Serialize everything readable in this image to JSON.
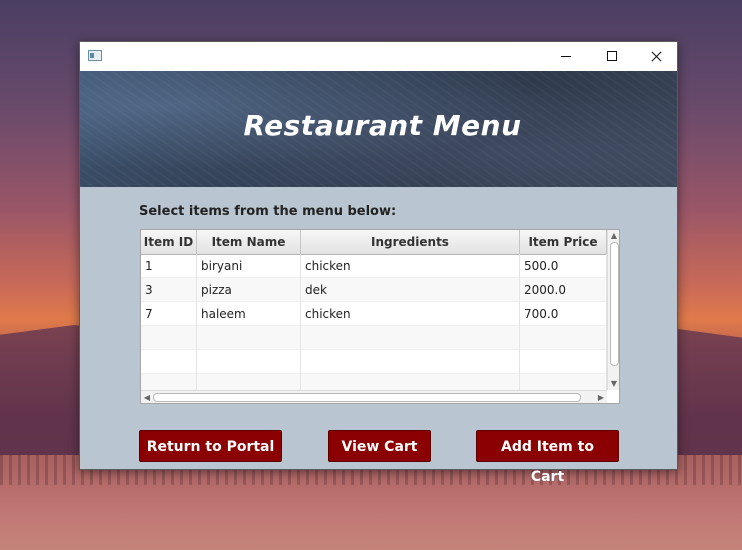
{
  "window": {
    "banner_title": "Restaurant Menu"
  },
  "instructions": "Select items from the menu below:",
  "table": {
    "columns": [
      "Item ID",
      "Item Name",
      "Ingredients",
      "Item Price"
    ],
    "rows": [
      [
        "1",
        "biryani",
        "chicken",
        "500.0"
      ],
      [
        "3",
        "pizza",
        "dek",
        "2000.0"
      ],
      [
        "7",
        "haleem",
        "chicken",
        "700.0"
      ]
    ]
  },
  "buttons": {
    "return": "Return to Portal",
    "view_cart": "View Cart",
    "add_item": "Add Item to Cart"
  },
  "colors": {
    "button_bg": "#8b0000",
    "window_bg": "#b9c6d1"
  },
  "icons": {
    "app": "app-window-icon",
    "minimize": "minimize-icon",
    "maximize": "maximize-icon",
    "close": "close-icon"
  }
}
